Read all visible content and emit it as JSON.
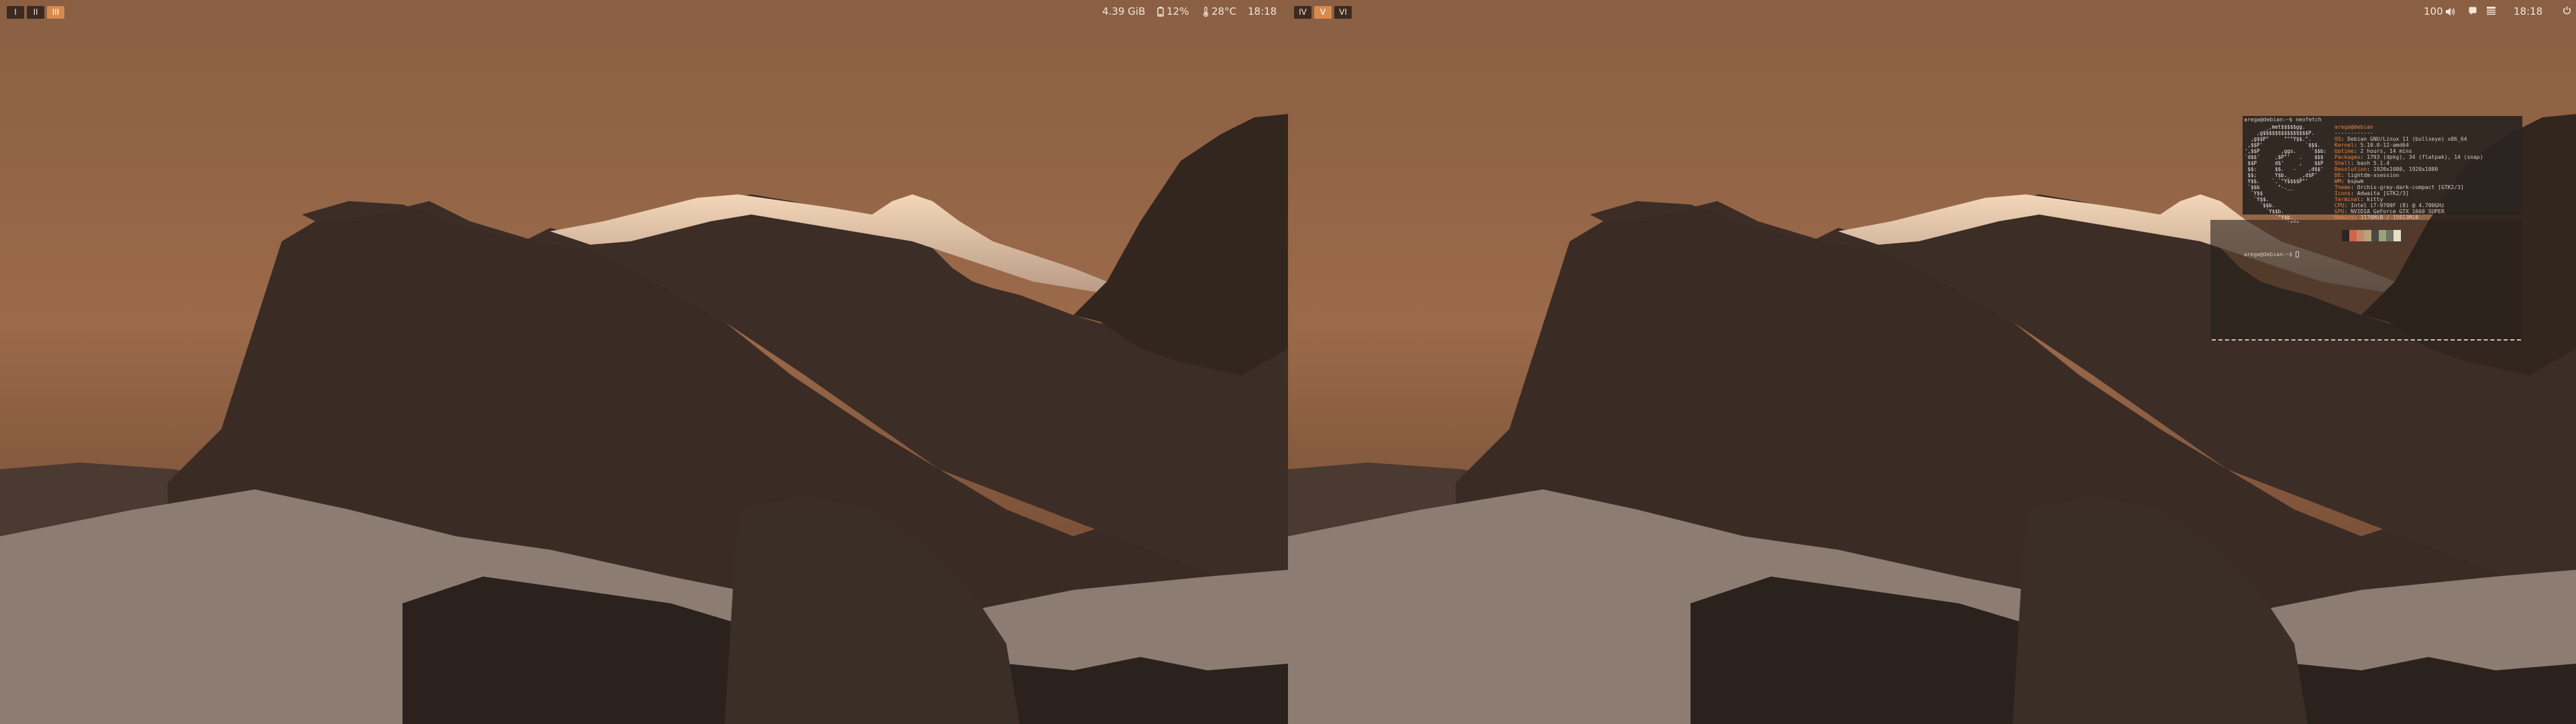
{
  "left_monitor": {
    "workspaces": [
      {
        "label": "I",
        "active": false
      },
      {
        "label": "II",
        "active": false
      },
      {
        "label": "III",
        "active": true
      }
    ],
    "memory": "4.39 GiB",
    "battery": "12%",
    "temperature": "28°C",
    "clock": "18:18"
  },
  "right_monitor": {
    "workspaces": [
      {
        "label": "IV",
        "active": false
      },
      {
        "label": "V",
        "active": true
      },
      {
        "label": "VI",
        "active": false
      }
    ],
    "volume": "100",
    "clock": "18:18"
  },
  "terminal": {
    "prompt_command": "arega@debian:~$ neofetch",
    "user_host": "arega@debian",
    "separator": "------------",
    "info": [
      {
        "key": "OS",
        "value": "Debian GNU/Linux 11 (bullseye) x86_64"
      },
      {
        "key": "Kernel",
        "value": "5.10.0-12-amd64"
      },
      {
        "key": "Uptime",
        "value": "2 hours, 14 mins"
      },
      {
        "key": "Packages",
        "value": "1793 (dpkg), 34 (flatpak), 14 (snap)"
      },
      {
        "key": "Shell",
        "value": "bash 5.1.4"
      },
      {
        "key": "Resolution",
        "value": "1920x1080, 1920x1080"
      },
      {
        "key": "DE",
        "value": "lightdm-xsession"
      },
      {
        "key": "WM",
        "value": "bspwm"
      },
      {
        "key": "Theme",
        "value": "Orchis-grey-dark-compact [GTK2/3]"
      },
      {
        "key": "Icons",
        "value": "Adwaita [GTK2/3]"
      },
      {
        "key": "Terminal",
        "value": "kitty"
      },
      {
        "key": "CPU",
        "value": "Intel i7-9700F (8) @ 4.700GHz"
      },
      {
        "key": "GPU",
        "value": "NVIDIA GeForce GTX 1660 SUPER"
      },
      {
        "key": "Memory",
        "value": "3176MiB / 15913MiB"
      }
    ],
    "art_lines": [
      "       _,met$$$$$gg.",
      "    ,g$$$$$$$$$$$$$$$P.",
      "  ,g$$P\"     \"\"\"Y$$.\".",
      " ,$$P'              `$$$.",
      "',$$P       ,ggs.     `$$b:",
      "`d$$'     ,$P\"'   .    $$$",
      " $$P      d$'     ,    $$P",
      " $$:      $$.   -    ,d$$'",
      " $$;      Y$b._   _,d$P'",
      " Y$$.    `.`\"Y$$$$P\"'",
      " `$$b      \"-.__",
      "  `Y$$",
      "   `Y$$.",
      "     `$$b.",
      "       `Y$$b.",
      "          `\"Y$b._",
      "              `\"\"\""
    ],
    "swatch_colors": [
      "#2b2523",
      "#d4634a",
      "#c8876a",
      "#b8a478",
      "#4c4743",
      "#9ba27a",
      "#6d7460",
      "#e6e0c2"
    ],
    "prompt2": "arega@debian:~$ "
  },
  "colors": {
    "accent": "#d88a4c",
    "terminal_key": "#e8843f"
  }
}
